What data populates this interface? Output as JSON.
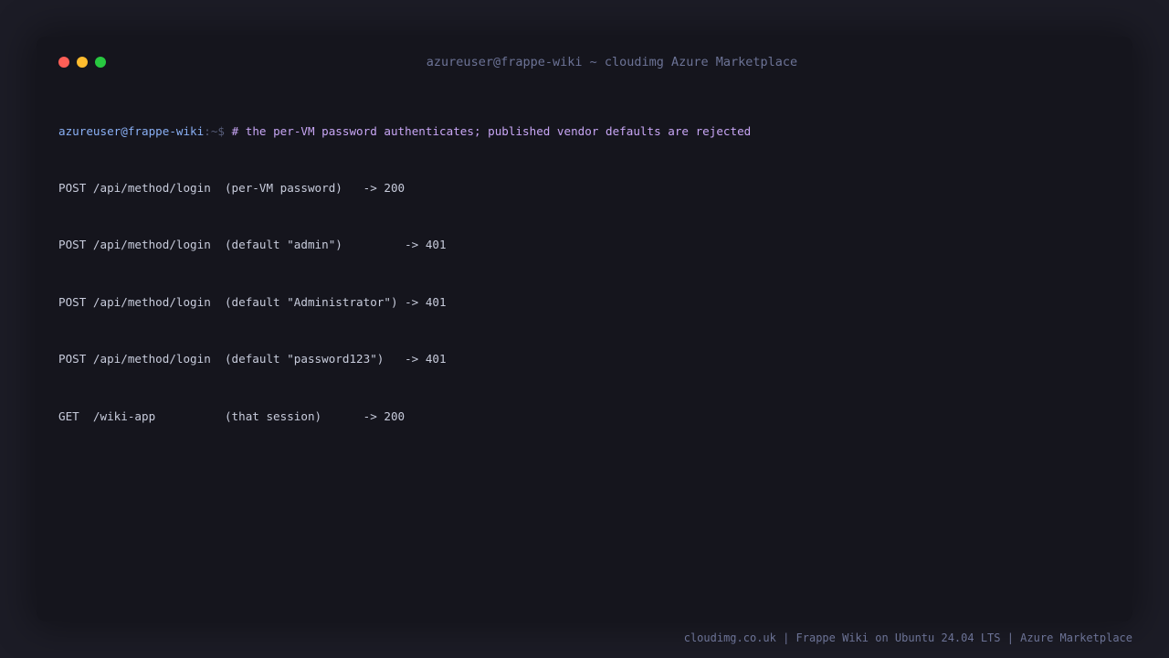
{
  "window": {
    "title": "azureuser@frappe-wiki ~ cloudimg Azure Marketplace",
    "controls": {
      "close_color": "#ff5f57",
      "minimize_color": "#febc2e",
      "maximize_color": "#28c840"
    }
  },
  "terminal": {
    "prompt": {
      "user_host": "azureuser@frappe-wiki",
      "path_symbol": ":~$",
      "command": "# the per-VM password authenticates; published vendor defaults are rejected"
    },
    "output_lines": [
      "POST /api/method/login  (per-VM password)   -> 200",
      "POST /api/method/login  (default \"admin\")         -> 401",
      "POST /api/method/login  (default \"Administrator\") -> 401",
      "POST /api/method/login  (default \"password123\")   -> 401",
      "GET  /wiki-app          (that session)      -> 200"
    ]
  },
  "footer": {
    "text": "cloudimg.co.uk | Frappe Wiki on Ubuntu 24.04 LTS | Azure Marketplace"
  },
  "colors": {
    "background": "#1c1c26",
    "window_background": "#15151d",
    "prompt_user": "#8ab0f5",
    "comment": "#c8a6f5",
    "output_text": "#c8ccdc",
    "muted": "#6c7396"
  }
}
